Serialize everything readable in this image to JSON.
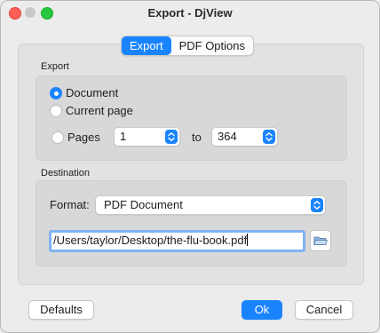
{
  "window": {
    "title": "Export - DjView"
  },
  "tabs": [
    {
      "label": "Export",
      "active": true
    },
    {
      "label": "PDF Options",
      "active": false
    }
  ],
  "export_group": {
    "label": "Export",
    "options": [
      {
        "label": "Document",
        "checked": true
      },
      {
        "label": "Current page",
        "checked": false
      },
      {
        "label": "Pages",
        "checked": false
      }
    ],
    "from_page": "1",
    "to_label": "to",
    "to_page": "364"
  },
  "destination_group": {
    "label": "Destination",
    "format_label": "Format:",
    "format_value": "PDF Document",
    "path_value": "/Users/taylor/Desktop/the-flu-book.pdf"
  },
  "buttons": {
    "defaults": "Defaults",
    "ok": "Ok",
    "cancel": "Cancel"
  },
  "icons": {
    "stepper": "up-down-chevron-icon",
    "select": "up-down-chevron-icon",
    "folder": "folder-open-icon"
  },
  "colors": {
    "accent": "#1a84ff"
  }
}
